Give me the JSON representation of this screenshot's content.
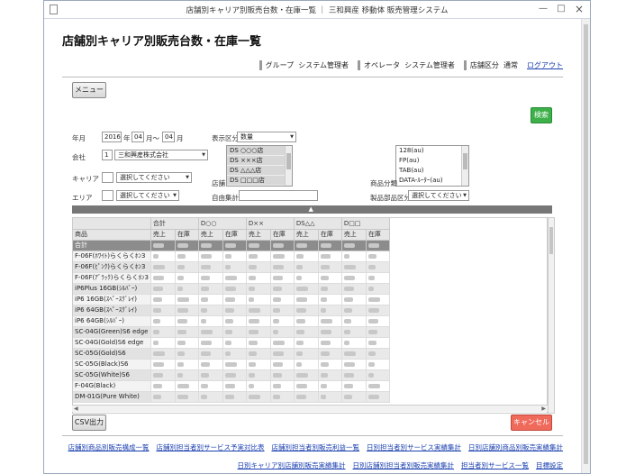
{
  "window": {
    "title": "店舗別キャリア別販売台数・在庫一覧 ｜ 三和興産 移動体 販売管理システム",
    "min": "—",
    "max": "□",
    "close": "×"
  },
  "header": {
    "page_title": "店舗別キャリア別販売台数・在庫一覧",
    "group_label": "グループ",
    "group_value": "システム管理者",
    "operator_label": "オペレータ",
    "operator_value": "システム管理者",
    "store_type_label": "店舗区分",
    "store_type_value": "通常",
    "logout": "ログアウト"
  },
  "toolbar": {
    "menu": "メニュー",
    "search": "検索",
    "csv": "CSV出力",
    "cancel": "キャンセル"
  },
  "form": {
    "year_month_label": "年月",
    "year": "2016",
    "year_unit": "年",
    "month_from": "04",
    "month_sep": "月～",
    "month_to": "04",
    "month_unit": "月",
    "company_label": "会社",
    "company_code": "1",
    "company_name": "三和興産株式会社",
    "carrier_label": "キャリア",
    "carrier_select": "選択してください",
    "area_label": "エリア",
    "area_select": "選択してください",
    "display_type_label": "表示区分",
    "display_type_value": "数量",
    "store_label": "店舗",
    "stores": [
      "DS ○○○店",
      "DS ×××店",
      "DS △△△店",
      "DS □□□店"
    ],
    "free_total_label": "自由集計",
    "product_category_label": "商品分類",
    "product_categories": [
      "128(au)",
      "FP(au)",
      "TAB(au)",
      "DATA-ﾙｰﾀｰ(au)"
    ],
    "product_part_label": "製品部品区分",
    "product_part_select": "選択してください"
  },
  "grid": {
    "group_headers": [
      "",
      "合計",
      "D○○",
      "D××",
      "DS△△",
      "D□□"
    ],
    "product_header": "商品",
    "sales_label": "売上",
    "stock_label": "在庫",
    "total_row": "合計",
    "rows": [
      "F-06F(ﾎﾜｲﾄ)らくらくﾎﾝ3",
      "F-06F(ﾋﾟﾝｸ)らくらくﾎﾝ3",
      "F-06F(ｱﾞﾗｯｸ)らくらくﾎﾝ3",
      "iP6Plus 16GB(ｼﾙﾊﾞｰ)",
      "iP6 16GB(ｽﾍﾟｰｽｸﾞﾚｲ)",
      "iP6 64GB(ｽﾍﾟｰｽｸﾞﾚｲ)",
      "iP6 64GB(ｼﾙﾊﾞｰ)",
      "SC-04G(Green)S6 edge",
      "SC-04G(Gold)S6 edge",
      "SC-05G(Gold)S6",
      "SC-05G(Black)S6",
      "SC-05G(White)S6",
      "F-04G(Black)",
      "DM-01G(Pure White)"
    ]
  },
  "footer": {
    "links_row1": [
      "店舗別商品別販売構成一覧",
      "店舗別担当者別サービス予実対比表",
      "店舗別担当者別販売利益一覧",
      "日別担当者別サービス実績集計",
      "日別店舗別商品別販売実績集計"
    ],
    "links_row2": [
      "日別キャリア別店舗別販売実績集計",
      "日別店舗別担当者別販売実績集計",
      "担当者別サービス一覧",
      "目標設定"
    ]
  }
}
